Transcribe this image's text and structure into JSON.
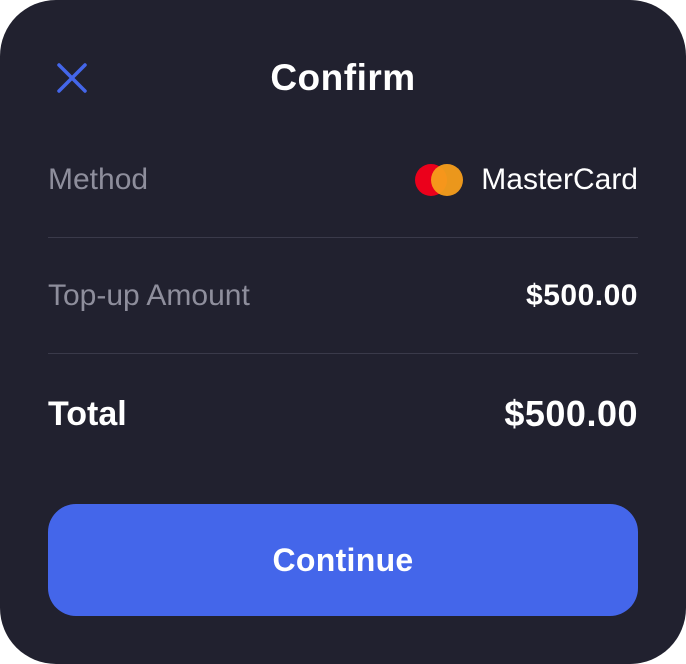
{
  "dialog": {
    "title": "Confirm",
    "close_icon": "close-icon",
    "accent_color": "#4466ea",
    "background_color": "#21212f"
  },
  "details": {
    "method_label": "Method",
    "method_value": "MasterCard",
    "method_icon": "mastercard-logo-icon",
    "amount_label": "Top-up Amount",
    "amount_value": "$500.00",
    "total_label": "Total",
    "total_value": "$500.00"
  },
  "actions": {
    "continue_label": "Continue"
  }
}
